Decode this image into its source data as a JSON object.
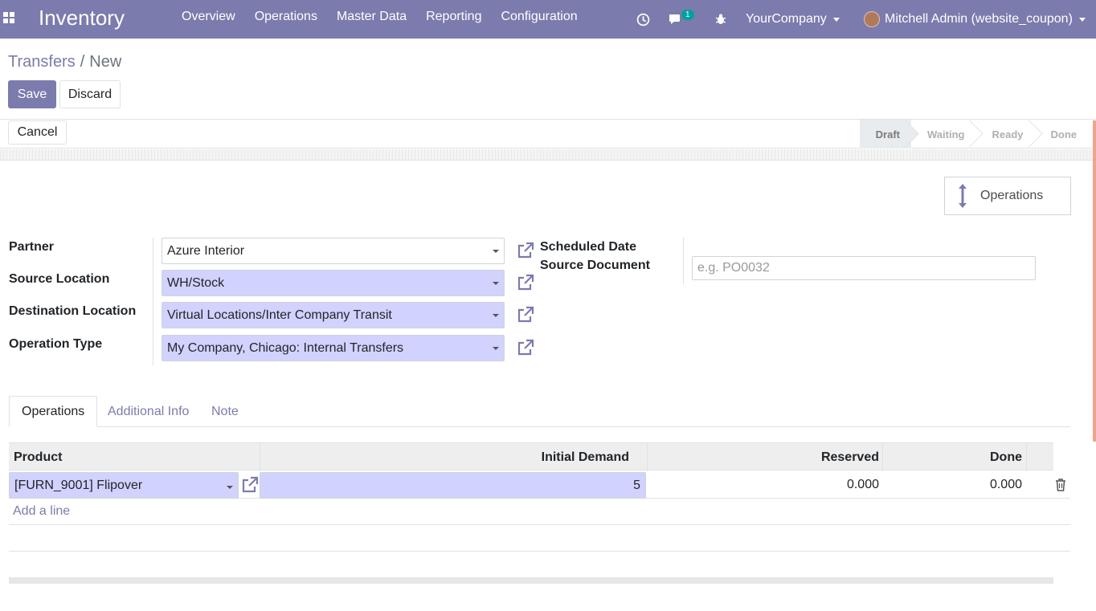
{
  "navbar": {
    "brand": "Inventory",
    "menu": [
      "Overview",
      "Operations",
      "Master Data",
      "Reporting",
      "Configuration"
    ],
    "chat_count": "1",
    "company": "YourCompany",
    "user": "Mitchell Admin (website_coupon)",
    "icons": [
      "apps-icon",
      "clock-icon",
      "chat-icon",
      "bug-icon"
    ]
  },
  "breadcrumb": {
    "parent": "Transfers",
    "separator": "/",
    "current": "New"
  },
  "buttons": {
    "save": "Save",
    "discard": "Discard",
    "cancel": "Cancel"
  },
  "statusbar": {
    "stages": [
      "Draft",
      "Waiting",
      "Ready",
      "Done"
    ],
    "active": "Draft"
  },
  "smart_button": {
    "label": "Operations"
  },
  "form": {
    "partner_label": "Partner",
    "partner_value": "Azure Interior",
    "source_location_label": "Source Location",
    "source_location_value": "WH/Stock",
    "destination_location_label": "Destination Location",
    "destination_location_value": "Virtual Locations/Inter Company Transit",
    "operation_type_label": "Operation Type",
    "operation_type_value": "My Company, Chicago: Internal Transfers",
    "scheduled_date_label": "Scheduled Date",
    "source_document_label": "Source Document",
    "source_document_placeholder": "e.g. PO0032"
  },
  "tabs": [
    "Operations",
    "Additional Info",
    "Note"
  ],
  "table": {
    "headers": [
      "Product",
      "Initial Demand",
      "Reserved",
      "Done"
    ],
    "rows": [
      {
        "product": "[FURN_9001] Flipover",
        "initial_demand": "5",
        "reserved": "0.000",
        "done": "0.000"
      }
    ],
    "add_line": "Add a line"
  },
  "colors": {
    "primary": "#7c7bad",
    "required_field": "#d2d2ff",
    "badge": "#00a09d"
  }
}
